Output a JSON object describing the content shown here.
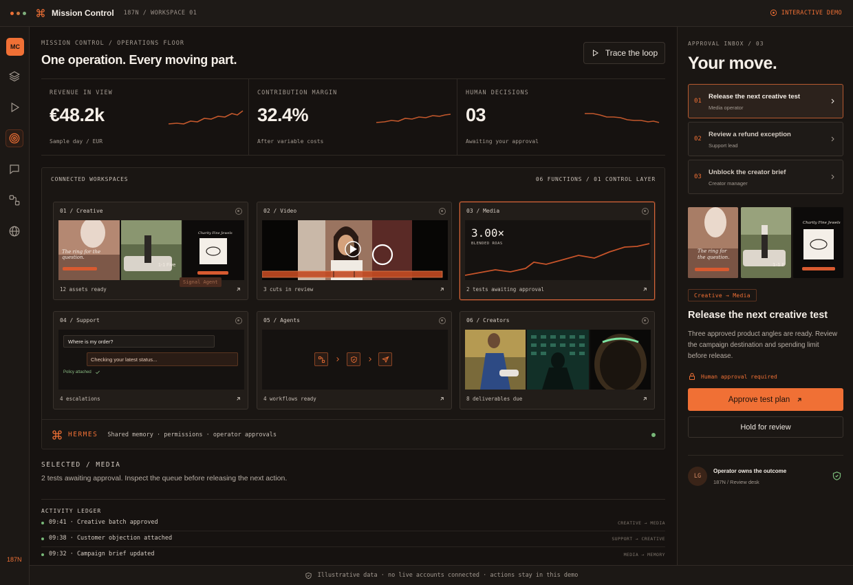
{
  "topbar": {
    "title": "Mission Control",
    "workspace": "187N / WORKSPACE 01",
    "demo_label": "INTERACTIVE DEMO",
    "colors": {
      "dot1": "#f07035",
      "dot2": "#c9763f",
      "dot3": "#7fae7c"
    }
  },
  "rail": {
    "avatar": "MC",
    "icons": [
      "layers-icon",
      "play-icon",
      "target-icon",
      "chat-icon",
      "workflow-icon",
      "globe-icon"
    ],
    "active": "target-icon",
    "footer": "187N"
  },
  "main": {
    "breadcrumb": "MISSION CONTROL / OPERATIONS FLOOR",
    "title": "One operation. Every moving part.",
    "trace_button": "Trace the loop",
    "metrics": [
      {
        "label": "REVENUE IN VIEW",
        "value": "€48.2k",
        "sub": "Sample day / EUR"
      },
      {
        "label": "CONTRIBUTION MARGIN",
        "value": "32.4%",
        "sub": "After variable costs"
      },
      {
        "label": "HUMAN DECISIONS",
        "value": "03",
        "sub": "Awaiting your approval"
      }
    ]
  },
  "workspaces": {
    "title": "CONNECTED WORKSPACES",
    "meta": "06 FUNCTIONS / 01 CONTROL LAYER",
    "cards": [
      {
        "title": "01 / Creative",
        "footer": "12 assets ready",
        "thumb_caption": "The ring for the question.",
        "thumb_brand": "Charity Fine Jewels",
        "thumb_date": "1-1 Five",
        "overlay": "Signal Agent"
      },
      {
        "title": "02 / Video",
        "footer": "3 cuts in review"
      },
      {
        "title": "03 / Media",
        "footer": "2 tests awaiting approval",
        "roas": "3.00×",
        "roas_label": "BLENDED ROAS"
      },
      {
        "title": "04 / Support",
        "footer": "4 escalations",
        "question": "Where is my order?",
        "reply": "Checking your latest status...",
        "policy": "Policy attached"
      },
      {
        "title": "05 / Agents",
        "footer": "4 workflows ready"
      },
      {
        "title": "06 / Creators",
        "footer": "8 deliverables due"
      }
    ]
  },
  "hermes": {
    "name": "HERMES",
    "desc": "Shared memory · permissions · operator approvals",
    "status_color": "#78b878"
  },
  "selected": {
    "label": "SELECTED / MEDIA",
    "text": "2 tests awaiting approval. Inspect the queue before releasing the next action."
  },
  "ledger": {
    "title": "ACTIVITY LEDGER",
    "rows": [
      {
        "text": "09:41 · Creative batch approved",
        "tag": "CREATIVE → MEDIA"
      },
      {
        "text": "09:38 · Customer objection attached",
        "tag": "SUPPORT → CREATIVE"
      },
      {
        "text": "09:32 · Campaign brief updated",
        "tag": "MEDIA → MEMORY"
      }
    ]
  },
  "footer": "Illustrative data · no live accounts connected · actions stay in this demo",
  "inbox": {
    "label": "APPROVAL INBOX / 03",
    "title": "Your move.",
    "tasks": [
      {
        "num": "01",
        "title": "Release the next creative test",
        "sub": "Media operator"
      },
      {
        "num": "02",
        "title": "Review a refund exception",
        "sub": "Support lead"
      },
      {
        "num": "03",
        "title": "Unblock the creator brief",
        "sub": "Creator manager"
      }
    ],
    "tag": "Creative → Media",
    "detail_title": "Release the next creative test",
    "detail_desc": "Three approved product angles are ready. Review the campaign destination and spending limit before release.",
    "requirement": "Human approval required",
    "approve": "Approve test plan",
    "hold": "Hold for review",
    "owner": {
      "initials": "LG",
      "title": "Operator owns the outcome",
      "sub": "187N / Review desk"
    }
  },
  "accent": "#f07035"
}
